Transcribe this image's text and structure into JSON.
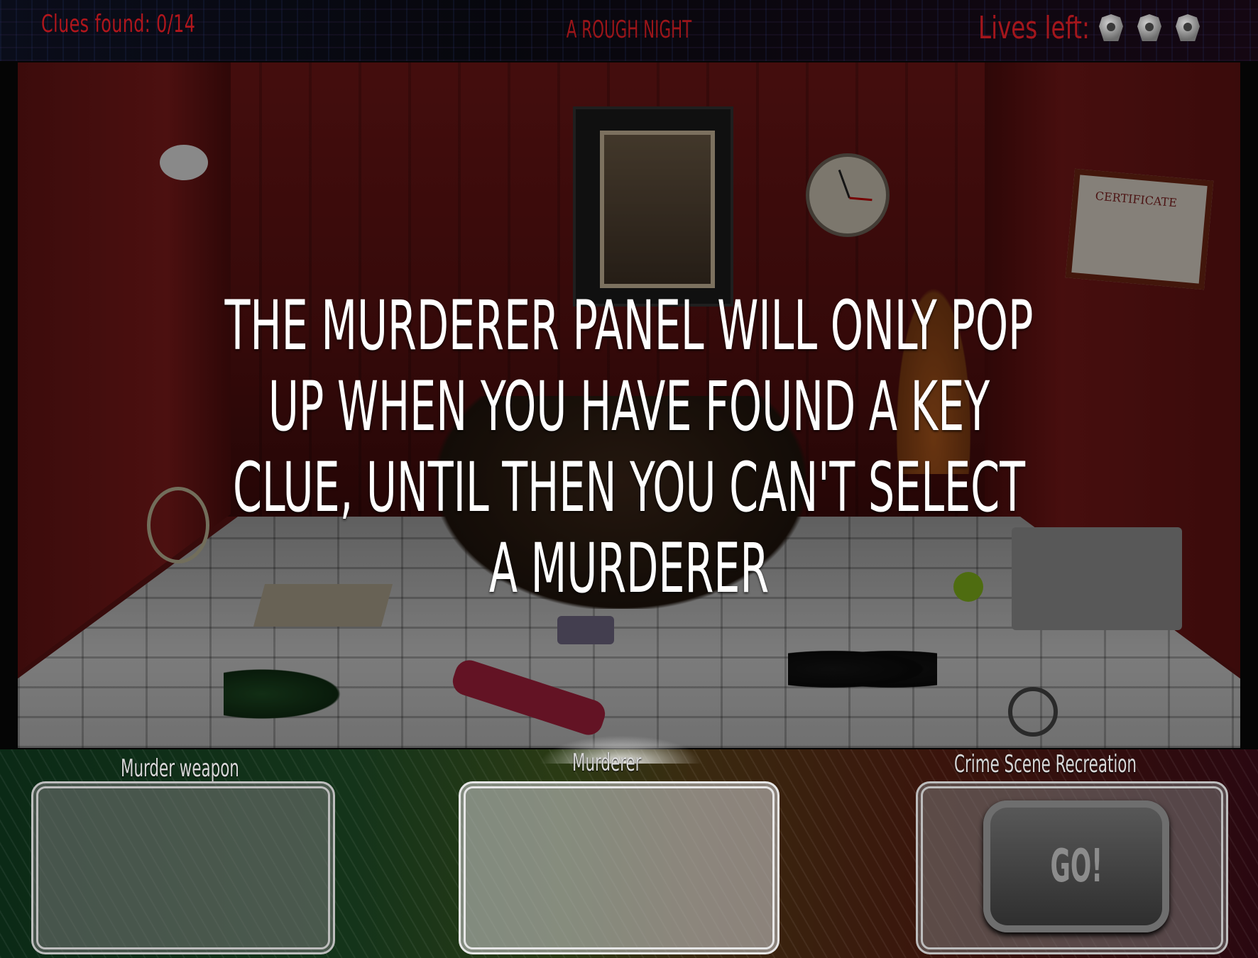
{
  "hud": {
    "clues_label": "Clues found: 0/14",
    "title": "A ROUGH NIGHT",
    "lives_label": "Lives  left:",
    "lives_count": 3
  },
  "scene": {
    "certificate_text": "CERTIFICATE",
    "message_lines": [
      "THE MURDERER PANEL WILL ONLY POP",
      "UP WHEN YOU HAVE FOUND A KEY",
      "CLUE, UNTIL THEN YOU CAN'T SELECT",
      "A MURDERER"
    ]
  },
  "panels": {
    "weapon_label": "Murder weapon",
    "murderer_label": "Murderer",
    "recreation_label": "Crime Scene Recreation",
    "go_label": "GO!"
  }
}
